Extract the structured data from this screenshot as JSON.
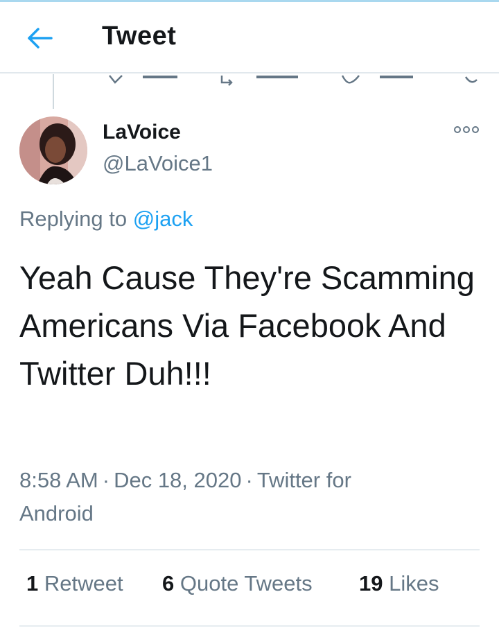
{
  "header": {
    "title": "Tweet",
    "back_icon": "arrow-left-icon",
    "accent_color": "#1da1f2"
  },
  "tweet": {
    "display_name": "LaVoice",
    "handle": "@LaVoice1",
    "replying_to_prefix": "Replying to",
    "replying_to_handle": "@jack",
    "text": "Yeah Cause They're Scamming Americans Via Facebook And Twitter Duh!!!",
    "time": "8:58 AM",
    "date": "Dec 18, 2020",
    "source_line1": "Twitter for",
    "source_line2": "Android",
    "separator": "·"
  },
  "stats": {
    "retweets_count": "1",
    "retweets_label": "Retweet",
    "quotes_count": "6",
    "quotes_label": "Quote Tweets",
    "likes_count": "19",
    "likes_label": "Likes"
  },
  "icons": {
    "more": "more-options-icon",
    "avatar": "avatar"
  }
}
